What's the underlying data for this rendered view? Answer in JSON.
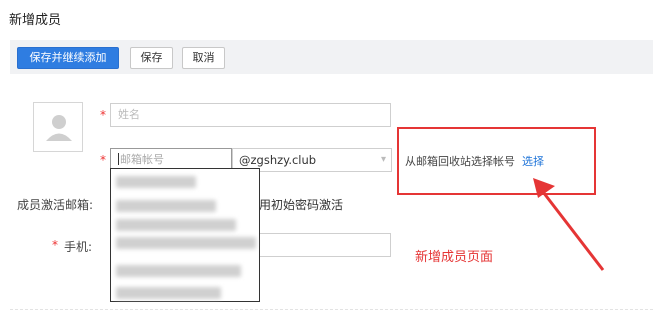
{
  "page": {
    "title": "新增成员"
  },
  "toolbar": {
    "save_continue_label": "保存并继续添加",
    "save_label": "保存",
    "cancel_label": "取消"
  },
  "form": {
    "required_mark": "*",
    "name": {
      "placeholder": "姓名"
    },
    "email": {
      "placeholder": "邮箱帐号",
      "domain": "@zgshzy.club"
    },
    "activation": {
      "label": "成员激活邮箱:",
      "option_text": "用初始密码激活"
    },
    "phone": {
      "label": "手机:"
    }
  },
  "recycle": {
    "text": "从邮箱回收站选择帐号",
    "link_label": "选择"
  },
  "annotation": {
    "text": "新增成员页面"
  },
  "colors": {
    "primary": "#2f7de1",
    "annotation_red": "#e53535",
    "link": "#1f74d8"
  }
}
